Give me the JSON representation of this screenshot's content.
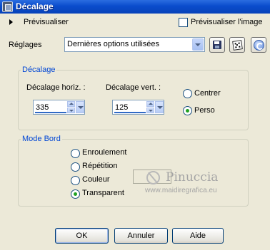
{
  "window": {
    "title": "Décalage"
  },
  "preview_bar": {
    "preview_label": "Prévisualiser",
    "preview_image_label": "Prévisualiser l'image",
    "preview_image_checked": false
  },
  "settings": {
    "label": "Réglages",
    "preset_value": "Dernières options utilisées"
  },
  "offset_group": {
    "legend": "Décalage",
    "horiz_label": "Décalage horiz. :",
    "horiz_value": "335",
    "vert_label": "Décalage vert. :",
    "vert_value": "125",
    "center_label": "Centrer",
    "perso_label": "Perso",
    "selected": "Perso"
  },
  "edge_group": {
    "legend": "Mode Bord",
    "options": [
      "Enroulement",
      "Répétition",
      "Couleur",
      "Transparent"
    ],
    "selected": "Transparent"
  },
  "watermark": {
    "name": "Pinuccia",
    "url": "www.maidiregrafica.eu"
  },
  "buttons": {
    "ok": "OK",
    "cancel": "Annuler",
    "help": "Aide"
  },
  "colors": {
    "title_bar": "#0a4ccc",
    "dialog_bg": "#ece9d8",
    "group_legend": "#0046d5",
    "radio_dot": "#21a121"
  }
}
